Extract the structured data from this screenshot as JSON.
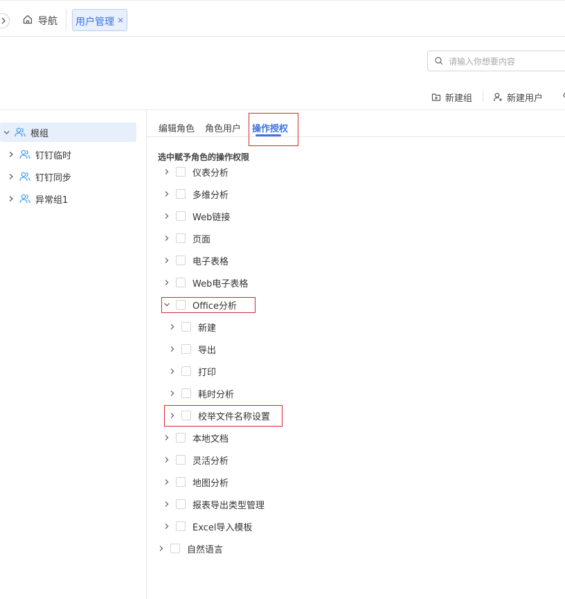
{
  "topbar": {
    "nav_label": "导航",
    "tab_label": "用户管理",
    "tab_close": "×"
  },
  "search": {
    "placeholder": "请输入你想要内容",
    "value": ""
  },
  "toolbar": {
    "new_group": "新建组",
    "new_user": "新建用户"
  },
  "tree": {
    "root": "根组",
    "children": [
      "钉钉临时",
      "钉钉同步",
      "异常组1"
    ]
  },
  "tabs": {
    "items": [
      "编辑角色",
      "角色用户",
      "操作授权"
    ],
    "active": "操作授权"
  },
  "permissions": {
    "title": "选中赋予角色的操作权限",
    "items": [
      "仪表分析",
      "多维分析",
      "Web链接",
      "页面",
      "电子表格",
      "Web电子表格",
      "Office分析",
      "新建",
      "导出",
      "打印",
      "耗时分析",
      "校举文件名称设置",
      "本地文档",
      "灵活分析",
      "地图分析",
      "报表导出类型管理",
      "Excel导入模板",
      "自然语言"
    ]
  },
  "colors": {
    "accent": "#3d72e4",
    "highlight": "#d9232a"
  },
  "icons": [
    "home-icon",
    "close-icon",
    "search-icon",
    "add-group-icon",
    "add-user-icon",
    "users-icon",
    "chevron-right-icon",
    "chevron-down-icon"
  ]
}
